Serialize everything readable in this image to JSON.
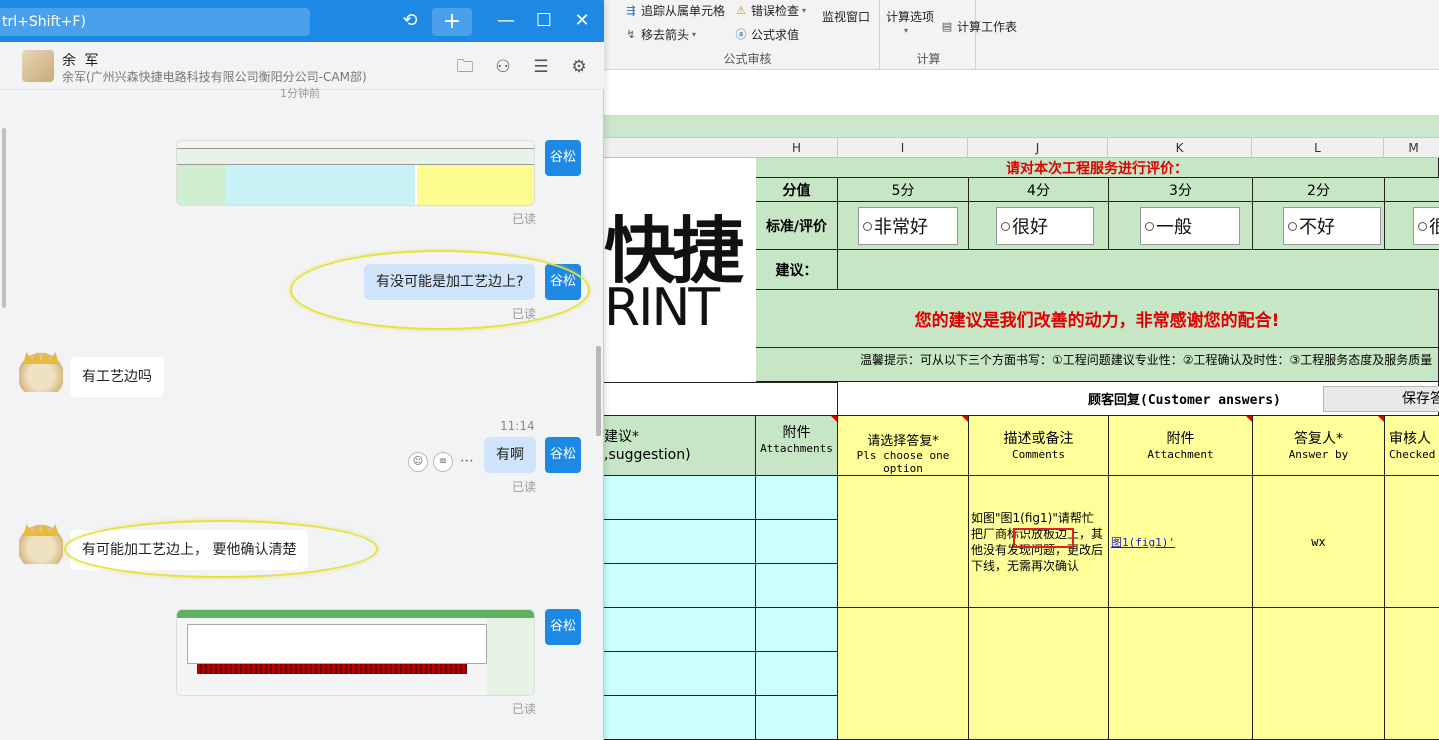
{
  "excel": {
    "ribbon": {
      "audit_group_label": "公式审核",
      "calc_group_label": "计算",
      "trace_dependents": "追踪从属单元格",
      "error_check": "错误检查",
      "remove_arrows": "移去箭头",
      "evaluate_formula": "公式求值",
      "watch_window": "监视窗口",
      "calc_options": "计算选项",
      "calc_sheet": "计算工作表"
    },
    "columns": [
      "H",
      "I",
      "J",
      "K",
      "L",
      "M"
    ],
    "logo_text": "快捷",
    "logo_sub": "RINT",
    "rating_title": "请对本次工程服务进行评价：",
    "score_label": "分值",
    "scores": [
      "5分",
      "4分",
      "3分",
      "2分"
    ],
    "standard_label": "标准/评价",
    "ratings": [
      "非常好",
      "很好",
      "一般",
      "不好",
      "很"
    ],
    "suggestion_label": "建议：",
    "thanks_text": "您的建议是我们改善的动力，非常感谢您的配合!",
    "tip_text": "温馨提示：可从以下三个方面书写：①工程问题建议专业性：②工程确认及时性：③工程服务态度及服务质量",
    "customer_answers": "顾客回复(Customer answers)",
    "save_button": "保存答",
    "headers": {
      "suggestion_cn": "建议*",
      "suggestion_en": ",suggestion)",
      "attach1_cn": "附件",
      "attach1_en": "Attachments",
      "choose_cn": "请选择答复*",
      "choose_en": "Pls choose one option",
      "comments_cn": "描述或备注",
      "comments_en": "Comments",
      "attach2_cn": "附件",
      "attach2_en": "Attachment",
      "answer_cn": "答复人*",
      "answer_en": "Answer by",
      "checked_cn": "审核人",
      "checked_en": "Checked"
    },
    "comment_text": "如图\"图1(fig1)\"请帮忙把厂商标识放板边上，其他没有发现问题，更改后下线，无需再次确认",
    "attachment_link": "图1(fig1)'",
    "answer_by": "wx"
  },
  "chat": {
    "search_placeholder": "trl+Shift+F)",
    "header_name": "余 军",
    "header_sub": "余军(广州兴森快捷电路科技有限公司衡阳分公司-CAM部)",
    "top_cut_text": "1分钟前",
    "my_name": "谷松",
    "read_label": "已读",
    "messages": {
      "m1": "有没可能是加工艺边上?",
      "m2": "有工艺边吗",
      "m3_time": "11:14",
      "m3": "有啊",
      "m4": "有可能加工艺边上，  要他确认清楚"
    }
  }
}
